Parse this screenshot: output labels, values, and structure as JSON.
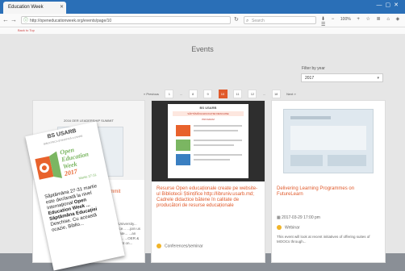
{
  "browser": {
    "tab_title": "Education Week",
    "url": "http://openeducationweek.org/events/page/10",
    "search_placeholder": "Search",
    "zoom": "100%",
    "subbar_text": "Back to Top"
  },
  "page": {
    "title": "Events",
    "filter_label": "Filter by year",
    "filter_value": "2017",
    "pagination": {
      "prev": "« Previous",
      "pages": [
        "1",
        "...",
        "8",
        "9",
        "10",
        "11",
        "12",
        "...",
        "18"
      ],
      "active_index": 4,
      "next": "Next »"
    }
  },
  "cards": [
    {
      "image_text": "2016 OER LEADERSHIP SUMMIT",
      "title": "Summit",
      "desc": "...small University... ...Distance... ...join us to celebrate... ...an exclusive... ...OER & OCW event on..."
    },
    {
      "image_header": "BS USARB",
      "image_subheader": "SĂPTĂMÂNA EDUCAȚIEI DESCHISE",
      "image_program": "PROGRAM",
      "title": "Resurse Open educaționale create pe website-ul Bibliotecii Științifice http://libruniv.usarb.md; Cadrele didactice bătene în calitate de producători de resurse educaționale",
      "meta": "Conferences/seminar"
    },
    {
      "title": "Delivering Learning Programmes on FutureLearn",
      "date": "2017-03-29 17:00 pm",
      "type": "Webinar",
      "desc": "This event will look at recent initiatives of offering suites of MOOCs through..."
    }
  ],
  "flyer": {
    "header": "BS USARB",
    "subheader": "BIBLIOTECA ȘTIINȚIFICĂ A USARB",
    "logo_text": [
      "Open",
      "Education",
      "Week",
      "2017"
    ],
    "dates": "Martie 27-31",
    "body": [
      "Săptămâna 27-31 martie",
      "este declarată la nivel",
      "internațional ",
      "Education Week ...",
      "Săptămâna Educației",
      "Deschise. Cu această",
      "ocazie, Biblio..."
    ],
    "bold_parts": [
      "Open",
      "Education Week",
      "Săptămâna Educației Deschise"
    ]
  },
  "colors": {
    "accent": "#e05a2b",
    "tab_bar": "#2a6fb7",
    "logo_orange": "#e8622c",
    "logo_green": "#7bb662"
  }
}
